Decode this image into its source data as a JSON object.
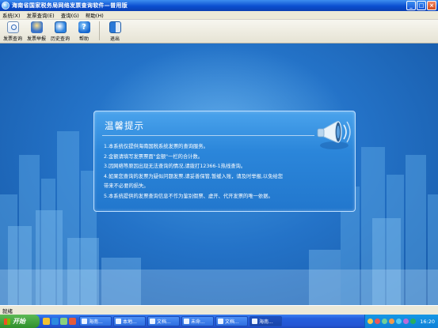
{
  "window": {
    "title": "海南省国家税务局网络发票查询软件—普用版"
  },
  "menu": {
    "items": [
      "系统(X)",
      "发票查询(E)",
      "查询(G)",
      "帮助(H)"
    ]
  },
  "toolbar": {
    "buttons": [
      {
        "label": "发票查询",
        "icon": "search-icon"
      },
      {
        "label": "发票举报",
        "icon": "report-icon"
      },
      {
        "label": "历史查询",
        "icon": "history-icon"
      },
      {
        "label": "帮助",
        "icon": "help-icon"
      },
      {
        "label": "退出",
        "icon": "exit-icon"
      }
    ]
  },
  "notice": {
    "title": "温馨提示",
    "lines": [
      "1.本系统仅提供海南国税系统发票的查询服务。",
      "2.金额请填写发票票面\"金额\"一栏的合计数。",
      "3.因网络等原因出现无法查询的情况,请拨打12366-1热线查询。",
      "4.如果您查询的发票为疑似问题发票,请妥善保管,暂缓入账，请及时举报,以免给您",
      "带来不必要的损失。",
      "5.本系统提供的发票查询信息不作为鉴别假票、虚开、代开发票的唯一依据。"
    ]
  },
  "statusbar": {
    "text": "就绪"
  },
  "taskbar": {
    "start_label": "开始",
    "tasks": [
      "海南...",
      "本地...",
      "文档...",
      "未命...",
      "文档...",
      "海南..."
    ],
    "clock": "16:20"
  },
  "colors": {
    "title_bar": "#0a4fd1",
    "background": "#2473c8",
    "panel": "#2b86da",
    "taskbar": "#245edc",
    "tray": "#0f80d7"
  }
}
